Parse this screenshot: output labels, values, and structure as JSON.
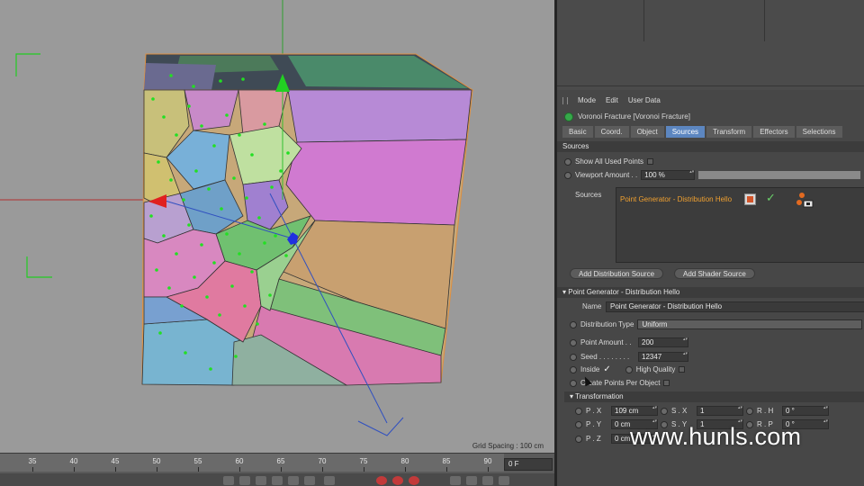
{
  "viewport": {
    "grid_spacing": "Grid Spacing : 100 cm"
  },
  "timeline": {
    "ticks": [
      "35",
      "40",
      "45",
      "50",
      "55",
      "60",
      "65",
      "70",
      "75",
      "80",
      "85",
      "90"
    ],
    "current_frame": "0 F"
  },
  "menubar": {
    "items": [
      "Mode",
      "Edit",
      "User Data"
    ]
  },
  "object": {
    "title": "Voronoi Fracture [Voronoi Fracture]"
  },
  "tabs": [
    {
      "label": "Basic",
      "active": false
    },
    {
      "label": "Coord.",
      "active": false
    },
    {
      "label": "Object",
      "active": false
    },
    {
      "label": "Sources",
      "active": true
    },
    {
      "label": "Transform",
      "active": false
    },
    {
      "label": "Effectors",
      "active": false
    },
    {
      "label": "Selections",
      "active": false
    }
  ],
  "sources_section": {
    "header": "Sources",
    "show_all_used_points": "Show All Used Points",
    "viewport_amount_label": "Viewport Amount . .",
    "viewport_amount_value": "100 %",
    "sources_label": "Sources",
    "source_item": "Point Generator - Distribution Hello",
    "add_distribution_source": "Add Distribution Source",
    "add_shader_source": "Add Shader Source"
  },
  "generator": {
    "header": "Point Generator - Distribution Hello",
    "name_label": "Name",
    "name_value": "Point Generator - Distribution Hello",
    "distribution_type_label": "Distribution Type",
    "distribution_type_value": "Uniform",
    "point_amount_label": "Point Amount . .",
    "point_amount_value": "200",
    "seed_label": "Seed . . . . . . . .",
    "seed_value": "12347",
    "inside_label": "Inside",
    "high_quality_label": "High Quality",
    "create_points_label": "Create Points Per Object"
  },
  "transformation": {
    "header": "Transformation",
    "rows": [
      {
        "p_label": "P . X",
        "p_value": "109 cm",
        "s_label": "S . X",
        "s_value": "1",
        "r_label": "R . H",
        "r_value": "0 °"
      },
      {
        "p_label": "P . Y",
        "p_value": "0 cm",
        "s_label": "S . Y",
        "s_value": "1",
        "r_label": "R . P",
        "r_value": "0 °"
      },
      {
        "p_label": "P . Z",
        "p_value": "0 cm",
        "s_label": "",
        "s_value": "",
        "r_label": "",
        "r_value": ""
      }
    ]
  },
  "watermark": "www.hunls.com",
  "colors": {
    "viewport_bg": "#9a9a9a",
    "panel_bg": "#474747",
    "active_tab": "#5c86c0",
    "source_item": "#f0a030",
    "point": "#22e022"
  }
}
